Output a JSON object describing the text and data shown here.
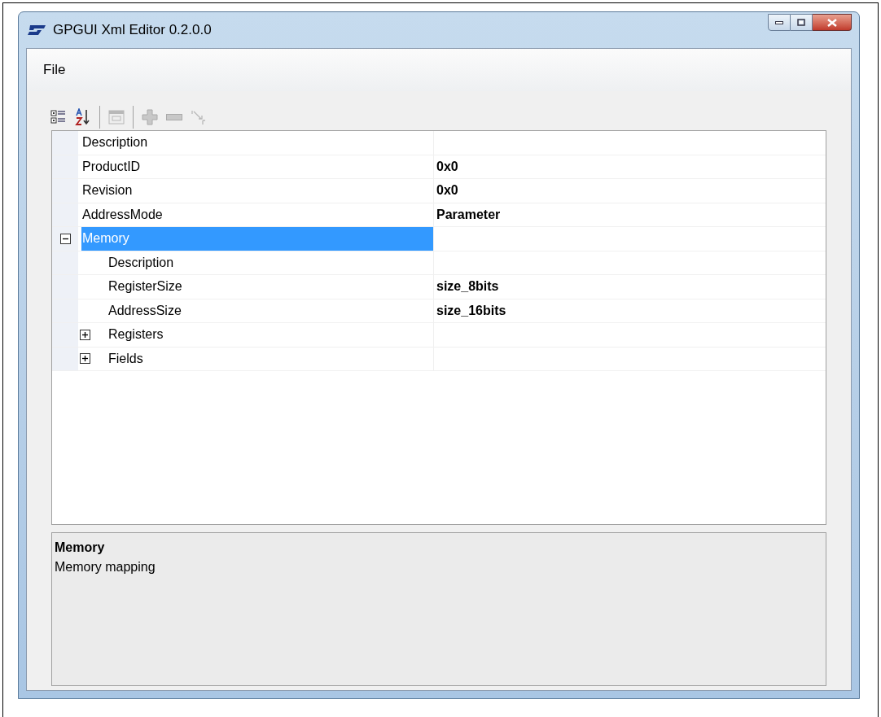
{
  "window": {
    "title": "GPGUI Xml Editor 0.2.0.0"
  },
  "menu": [
    {
      "label": "File"
    }
  ],
  "toolbar": [
    {
      "kind": "categorized",
      "disabled": false
    },
    {
      "kind": "alphabetical",
      "disabled": false
    },
    {
      "kind": "separator"
    },
    {
      "kind": "pages",
      "disabled": true
    },
    {
      "kind": "separator"
    },
    {
      "kind": "add",
      "disabled": true
    },
    {
      "kind": "remove",
      "disabled": true
    },
    {
      "kind": "rename",
      "disabled": true
    }
  ],
  "properties": [
    {
      "name": "Description",
      "selected": false
    },
    {
      "name": "ProductID",
      "value": "0x0",
      "selected": false
    },
    {
      "name": "Revision",
      "value": "0x0",
      "selected": false
    },
    {
      "name": "AddressMode",
      "value": "Parameter",
      "selected": false
    },
    {
      "name": "Memory",
      "selected": true,
      "expanded": true,
      "children": [
        {
          "name": "Description",
          "selected": false
        },
        {
          "name": "RegisterSize",
          "value": "size_8bits",
          "selected": false
        },
        {
          "name": "AddressSize",
          "value": "size_16bits",
          "selected": false
        },
        {
          "name": "Registers",
          "selected": false,
          "expanded": false
        },
        {
          "name": "Fields",
          "selected": false,
          "expanded": false
        }
      ]
    }
  ],
  "help": {
    "title": "Memory",
    "text": "Memory mapping"
  }
}
